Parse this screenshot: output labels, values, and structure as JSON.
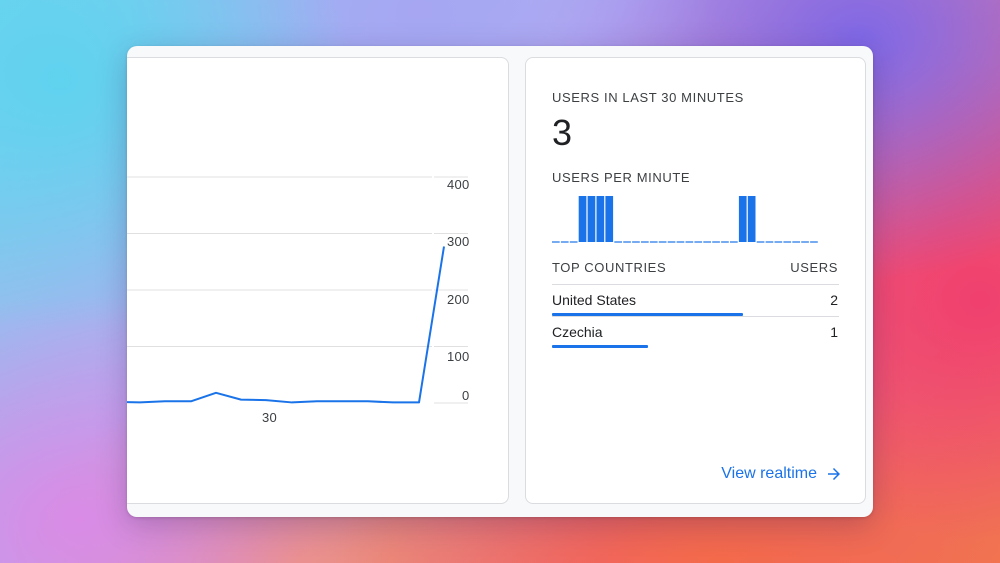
{
  "left_chart": {
    "y_ticks": [
      "400",
      "300",
      "200",
      "100",
      "0"
    ],
    "x_ticks": [
      "30"
    ],
    "colors": {
      "line": "#1a73e8",
      "grid": "#e0e0e0"
    }
  },
  "chart_data": {
    "type": "line",
    "xlabel": "",
    "ylabel": "",
    "ylim": [
      0,
      400
    ],
    "x_tick_labels": [
      "30"
    ],
    "y_tick_labels": [
      "0",
      "100",
      "200",
      "300",
      "400"
    ],
    "series": [
      {
        "values": [
          2,
          1,
          3,
          3,
          18,
          6,
          5,
          1,
          3,
          3,
          3,
          1,
          1,
          277
        ]
      }
    ],
    "grid": true
  },
  "realtime": {
    "title": "USERS IN LAST 30 MINUTES",
    "value": "3",
    "per_minute_label": "USERS PER MINUTE",
    "per_minute_values": [
      0,
      0,
      0,
      1,
      1,
      1,
      1,
      0,
      0,
      0,
      0,
      0,
      0,
      0,
      0,
      0,
      0,
      0,
      0,
      0,
      0,
      1,
      1,
      0,
      0,
      0,
      0,
      0,
      0,
      0
    ],
    "bar_color": "#1a73e8",
    "table": {
      "headers": [
        "TOP COUNTRIES",
        "USERS"
      ],
      "rows": [
        {
          "country": "United States",
          "users": "2",
          "share": 1.0
        },
        {
          "country": "Czechia",
          "users": "1",
          "share": 0.5
        }
      ]
    },
    "link": {
      "label": "View realtime",
      "icon": "arrow-right-icon"
    }
  }
}
